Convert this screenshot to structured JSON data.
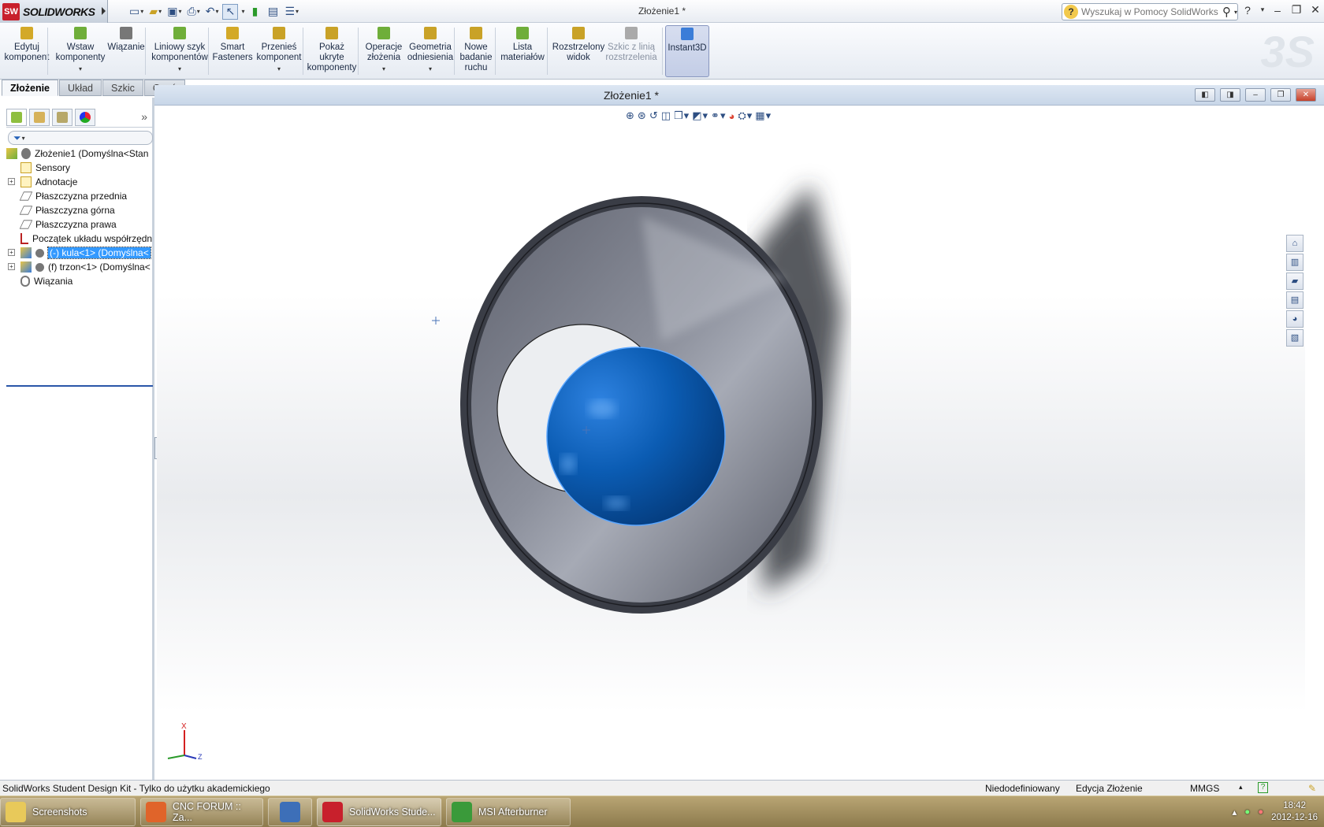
{
  "app": {
    "name": "SOLIDWORKS",
    "title": "Złożenie1 *"
  },
  "search": {
    "placeholder": "Wyszukaj w Pomocy SolidWorks"
  },
  "command_manager": [
    {
      "id": "edit-component",
      "label1": "Edytuj",
      "label2": "komponent",
      "label3": "",
      "has_menu": false,
      "disabled": false,
      "active": false,
      "icon": "edit-component-icon"
    },
    {
      "id": "insert-components",
      "label1": "Wstaw",
      "label2": "komponenty",
      "label3": "",
      "has_menu": true,
      "disabled": false,
      "active": false,
      "icon": "insert-components-icon"
    },
    {
      "id": "mate",
      "label1": "Wiązanie",
      "label2": "",
      "label3": "",
      "has_menu": false,
      "disabled": false,
      "active": false,
      "icon": "mate-paperclip-icon"
    },
    {
      "id": "linear-pattern",
      "label1": "Liniowy szyk",
      "label2": "komponentów",
      "label3": "",
      "has_menu": true,
      "disabled": false,
      "active": false,
      "icon": "linear-pattern-icon"
    },
    {
      "id": "smart-fasteners",
      "label1": "Smart",
      "label2": "Fasteners",
      "label3": "",
      "has_menu": false,
      "disabled": false,
      "active": false,
      "icon": "smart-fasteners-icon"
    },
    {
      "id": "move-component",
      "label1": "Przenieś",
      "label2": "komponent",
      "label3": "",
      "has_menu": true,
      "disabled": false,
      "active": false,
      "icon": "move-component-icon"
    },
    {
      "id": "show-hidden",
      "label1": "Pokaż",
      "label2": "ukryte",
      "label3": "komponenty",
      "has_menu": false,
      "disabled": false,
      "active": false,
      "icon": "show-hidden-icon"
    },
    {
      "id": "assembly-features",
      "label1": "Operacje",
      "label2": "złożenia",
      "label3": "",
      "has_menu": true,
      "disabled": false,
      "active": false,
      "icon": "assembly-features-icon"
    },
    {
      "id": "reference-geometry",
      "label1": "Geometria",
      "label2": "odniesienia",
      "label3": "",
      "has_menu": true,
      "disabled": false,
      "active": false,
      "icon": "reference-geometry-icon"
    },
    {
      "id": "new-motion-study",
      "label1": "Nowe",
      "label2": "badanie",
      "label3": "ruchu",
      "has_menu": false,
      "disabled": false,
      "active": false,
      "icon": "motion-study-icon"
    },
    {
      "id": "bill-of-materials",
      "label1": "Lista",
      "label2": "materiałów",
      "label3": "",
      "has_menu": false,
      "disabled": false,
      "active": false,
      "icon": "bom-table-icon"
    },
    {
      "id": "exploded-view",
      "label1": "Rozstrzelony",
      "label2": "widok",
      "label3": "",
      "has_menu": false,
      "disabled": false,
      "active": false,
      "icon": "exploded-view-icon"
    },
    {
      "id": "explode-line-sketch",
      "label1": "Szkic z linią",
      "label2": "rozstrzelenia",
      "label3": "",
      "has_menu": false,
      "disabled": true,
      "active": false,
      "icon": "explode-line-sketch-icon"
    },
    {
      "id": "instant3d",
      "label1": "Instant3D",
      "label2": "",
      "label3": "",
      "has_menu": false,
      "disabled": false,
      "active": true,
      "icon": "instant3d-icon"
    }
  ],
  "tabs": [
    "Złożenie",
    "Układ",
    "Szkic",
    "Oceń"
  ],
  "active_tab": "Złożenie",
  "tree": {
    "root": "Złożenie1  (Domyślna<Stan",
    "items": [
      {
        "label": "Sensory",
        "icon": "sensors-icon",
        "expandable": false,
        "selected": false
      },
      {
        "label": "Adnotacje",
        "icon": "annotations-icon",
        "expandable": true,
        "selected": false
      },
      {
        "label": "Płaszczyzna przednia",
        "icon": "plane-icon",
        "expandable": false,
        "selected": false
      },
      {
        "label": "Płaszczyzna górna",
        "icon": "plane-icon",
        "expandable": false,
        "selected": false
      },
      {
        "label": "Płaszczyzna prawa",
        "icon": "plane-icon",
        "expandable": false,
        "selected": false
      },
      {
        "label": "Początek układu współrzędn",
        "icon": "origin-icon",
        "expandable": false,
        "selected": false
      },
      {
        "label": "(-) kula<1> (Domyślna<",
        "icon": "part-icon",
        "expandable": true,
        "selected": true
      },
      {
        "label": "(f) trzon<1> (Domyślna<",
        "icon": "part-icon",
        "expandable": true,
        "selected": false
      },
      {
        "label": "Wiązania",
        "icon": "mates-icon",
        "expandable": false,
        "selected": false
      }
    ]
  },
  "triad": {
    "x_label": "X",
    "z_label": "Z"
  },
  "colors": {
    "accent": "#2a56a8",
    "selection": "#3399ff",
    "ball": "#0b5cb3",
    "body": "#737784"
  },
  "status": {
    "left": "SolidWorks Student Design Kit - Tylko do użytku akademickiego",
    "state": "Niedodefiniowany",
    "mode": "Edycja Złożenie",
    "units": "MMGS",
    "help": "?"
  },
  "taskbar": {
    "items": [
      {
        "label": "Screenshots",
        "icon": "folder-icon",
        "color": "#e8c95a"
      },
      {
        "label": "CNC FORUM :: Za...",
        "icon": "firefox-icon",
        "color": "#e0642a"
      },
      {
        "label": "",
        "icon": "thunderbird-icon",
        "color": "#3d6fb8"
      },
      {
        "label": "SolidWorks Stude...",
        "icon": "solidworks-icon",
        "color": "#c8202c"
      },
      {
        "label": "MSI Afterburner",
        "icon": "afterburner-icon",
        "color": "#3a9a3a"
      }
    ],
    "time": "18:42",
    "date": "2012-12-16"
  }
}
